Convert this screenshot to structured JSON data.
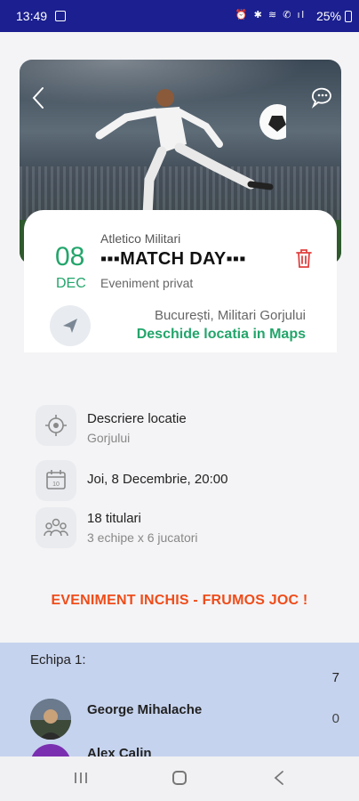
{
  "status_bar": {
    "time": "13:49",
    "icons": "⏰ ✱ ≋ ✆ ıl",
    "battery": "25%"
  },
  "event": {
    "organizer": "Atletico Militari",
    "title": "▪▪▪MATCH DAY▪▪▪",
    "privacy": "Eveniment privat",
    "day": "08",
    "month": "DEC",
    "address": "București, Militari Gorjului",
    "maps_link": "Deschide locatia in Maps"
  },
  "details": [
    {
      "icon": "target-icon",
      "title": "Descriere locatie",
      "subtitle": "Gorjului"
    },
    {
      "icon": "calendar-icon",
      "title": "Joi, 8 Decembrie, 20:00",
      "subtitle": ""
    },
    {
      "icon": "group-icon",
      "title": "18 titulari",
      "subtitle": "3 echipe x 6 jucatori"
    }
  ],
  "closed_message": "EVENIMENT INCHIS - FRUMOS JOC !",
  "team": {
    "name": "Echipa 1:",
    "count": "7",
    "players": [
      {
        "name": "George Mihalache",
        "score": "0"
      },
      {
        "name": "Alex Calin",
        "score": ""
      }
    ]
  },
  "colors": {
    "accent_green": "#23a56b",
    "danger_red": "#e0403f",
    "closed_orange": "#ef4c1a",
    "team_bg": "#c6d3ee",
    "status_bar": "#1b1f8f"
  }
}
